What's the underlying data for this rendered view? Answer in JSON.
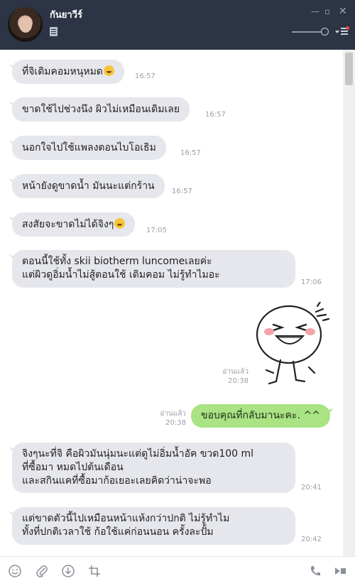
{
  "header": {
    "contact_name": "กันยาวีร์",
    "icons": [
      "avatar",
      "note-icon",
      "minimize-icon",
      "maximize-icon",
      "close-icon",
      "volume-slider",
      "menu-icon"
    ],
    "window_controls": {
      "minimize": "—",
      "maximize": "▫",
      "close": "✕"
    }
  },
  "messages": [
    {
      "dir": "in",
      "text": "ที่จิเดิมคอมหนุหมด",
      "emoji": "laugh-cry",
      "time": "16:57"
    },
    {
      "dir": "in",
      "text": "ขาดใช้ไปช่วงนึง ผิวไม่เหมือนเดิมเลย",
      "time": "16:57"
    },
    {
      "dir": "in",
      "text": "นอกใจไปใช้แพลงตอนไบโอเธิม",
      "time": "16:57"
    },
    {
      "dir": "in",
      "text": "หน้ายังดูขาดน้ำ มันนะแต่กร้าน",
      "time": "16:57"
    },
    {
      "dir": "in",
      "text": "สงสัยจะขาดไม่ได้จิงๆ",
      "emoji": "crying",
      "time": "17:05"
    },
    {
      "dir": "in",
      "text": "ตอนนี้ใช้ทั้ง skii biotherm luncome​เลยค่ะ\nแต่ผิวดูอิ่มน้ำไม่สู้ตอนใช้ เดิมคอม ไม่รู้ทำไมอะ",
      "time": "17:06"
    },
    {
      "dir": "out",
      "type": "sticker",
      "read": "อ่านแล้ว",
      "time": "20:38"
    },
    {
      "dir": "out",
      "text": "ขอบคุณที่กลับมานะคะ. ^^",
      "read": "อ่านแล้ว",
      "time": "20:38"
    },
    {
      "dir": "in",
      "text": "จิงๆนะที่จิ คือผิวมันนุ่มนะแต่ดูไม่อิ่มน้ำอัค ขวด100 ml\nที่ซื้อมา หมดไปต้นเดือน\nและสกินแคที่ซื้อมาก้อเยอะเลยคิดว่าน่าจะพอ",
      "time": "20:41"
    },
    {
      "dir": "in",
      "text": "แต่ขาดตัวนี้ไปเหมือนหน้าแห้งกว่าปกติ ไม่รู้ทำไม\nทั้งที่ปกติเวลาใช้ ก้อใช้แค่ก่อนนอน ครั้งละปั้ม",
      "time": "20:42"
    }
  ],
  "footer": {
    "icons": [
      "emoji-icon",
      "attach-icon",
      "download-icon",
      "crop-icon",
      "phone-icon",
      "video-icon"
    ]
  }
}
